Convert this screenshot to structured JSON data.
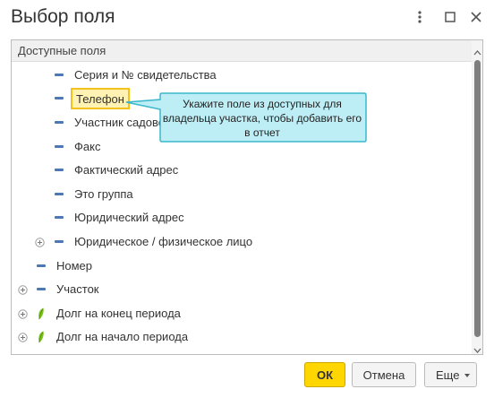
{
  "window": {
    "title": "Выбор поля",
    "controls": [
      "more-vertical-icon",
      "maximize-icon",
      "close-icon"
    ]
  },
  "panel": {
    "header": "Доступные поля",
    "items": [
      {
        "label": "Серия и № свидетельства",
        "icon": "field-dash-icon",
        "expandable": false,
        "selected": false
      },
      {
        "label": "Телефон",
        "icon": "field-dash-icon",
        "expandable": false,
        "selected": true
      },
      {
        "label": "Участник садово",
        "icon": "field-dash-icon",
        "expandable": false,
        "selected": false
      },
      {
        "label": "Факс",
        "icon": "field-dash-icon",
        "expandable": false,
        "selected": false
      },
      {
        "label": "Фактический адрес",
        "icon": "field-dash-icon",
        "expandable": false,
        "selected": false
      },
      {
        "label": "Это группа",
        "icon": "field-dash-icon",
        "expandable": false,
        "selected": false
      },
      {
        "label": "Юридический адрес",
        "icon": "field-dash-icon",
        "expandable": false,
        "selected": false
      },
      {
        "label": "Юридическое / физическое лицо",
        "icon": "field-dash-icon",
        "expandable": true,
        "selected": false
      },
      {
        "label": "Номер",
        "icon": "field-dash-icon",
        "expandable": false,
        "selected": false
      },
      {
        "label": "Участок",
        "icon": "field-dash-icon",
        "expandable": true,
        "selected": false
      },
      {
        "label": "Долг на конец периода",
        "icon": "resource-leaf-icon",
        "expandable": true,
        "selected": false
      },
      {
        "label": "Долг на начало периода",
        "icon": "resource-leaf-icon",
        "expandable": true,
        "selected": false
      }
    ]
  },
  "callout": {
    "text": "Укажите поле из доступных для владельца участка, чтобы добавить его в отчет"
  },
  "buttons": {
    "ok": "ОК",
    "cancel": "Отмена",
    "more": "Еще"
  },
  "colors": {
    "accent_yellow": "#ffd600",
    "selection_fill": "#fff2b3",
    "selection_border": "#f3c21c",
    "field_dash": "#4c79b6",
    "resource_leaf": "#7cc41c",
    "callout_fill": "#bdeef5",
    "callout_border": "#3cb7cc"
  }
}
